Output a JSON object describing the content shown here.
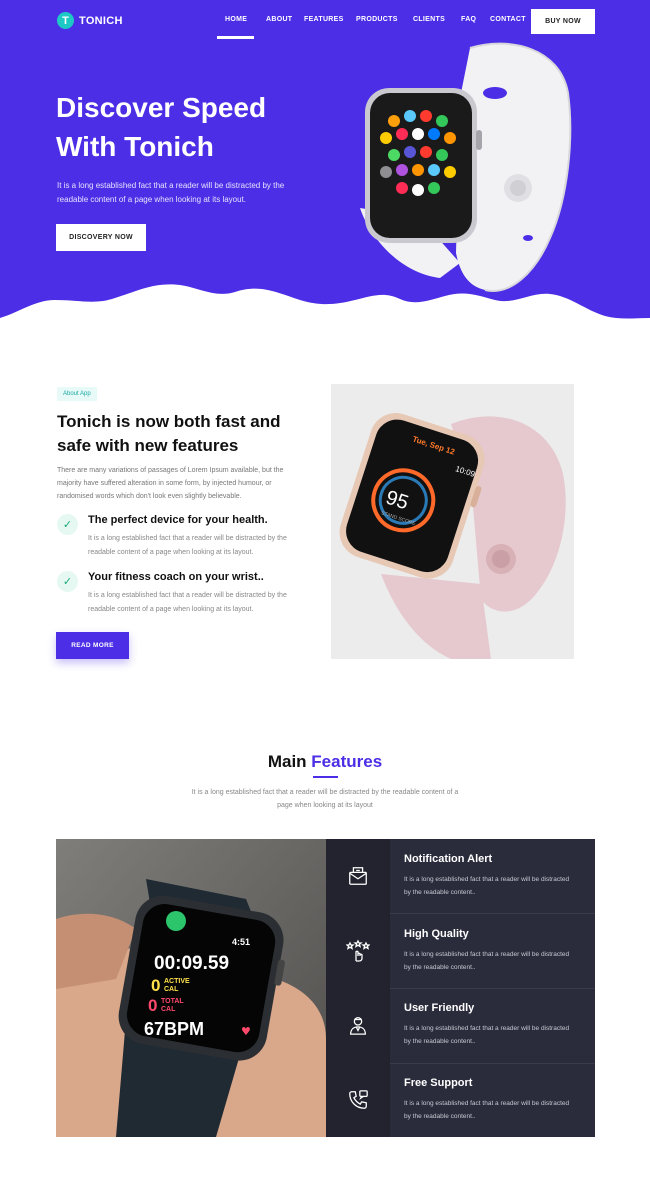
{
  "brand": {
    "logo_letter": "T",
    "name": "TONICH"
  },
  "nav": {
    "items": [
      {
        "label": "HOME",
        "active": true
      },
      {
        "label": "ABOUT"
      },
      {
        "label": "FEATURES"
      },
      {
        "label": "PRODUCTS"
      },
      {
        "label": "CLIENTS"
      },
      {
        "label": "FAQ"
      },
      {
        "label": "CONTACT"
      }
    ],
    "cta": "BUY NOW"
  },
  "hero": {
    "title_line1": "Discover Speed",
    "title_line2": "With Tonich",
    "text": "It is a long established fact that a reader will be distracted by the readable content of a page when looking at its layout.",
    "button": "DISCOVERY NOW"
  },
  "about": {
    "tag": "About App",
    "title": "Tonich is now both fast and safe with new features",
    "text": "There are many variations of passages of Lorem Ipsum available, but the majority have suffered alteration in some form, by injected humour, or randomised words which don't look even slightly believable.",
    "features": [
      {
        "title": "The perfect device for your health.",
        "text": "It is a long established fact that a reader will be distracted by the readable content of a page when looking at its layout."
      },
      {
        "title": "Your fitness coach on your wrist..",
        "text": "It is a long established fact that a reader will be distracted by the readable content of a page when looking at its layout."
      }
    ],
    "button": "READ MORE",
    "watch_screen": {
      "date": "Tue, Sep 12",
      "time": "10:09",
      "number": "95",
      "label": "STAND SCORE"
    }
  },
  "main_features": {
    "title_part1": "Main",
    "title_part2": "Features",
    "text": "It is a long established fact that a reader will be distracted by the readable content of a page when looking at its layout",
    "watch_screen": {
      "clock": "4:51",
      "timer": "00:09.59",
      "active": "0",
      "active_label1": "ACTIVE",
      "active_label2": "CAL",
      "total": "0",
      "total_label1": "TOTAL",
      "total_label2": "CAL",
      "bpm": "67BPM"
    },
    "items": [
      {
        "title": "Notification Alert",
        "text": "It is a long established fact that a reader will be distracted by the readable content..",
        "icon": "mail-icon"
      },
      {
        "title": "High Quality",
        "text": "It is a long established fact that a reader will be distracted by the readable content..",
        "icon": "rating-hand-icon"
      },
      {
        "title": "User Friendly",
        "text": "It is a long established fact that a reader will be distracted by the readable content..",
        "icon": "user-icon"
      },
      {
        "title": "Free Support",
        "text": "It is a long established fact that a reader will be distracted by the readable content..",
        "icon": "phone-support-icon"
      }
    ]
  },
  "colors": {
    "primary": "#4b2ee6",
    "teal": "#1ec8c5",
    "dark": "#2a2c3c",
    "dark_alt": "#22232f"
  }
}
